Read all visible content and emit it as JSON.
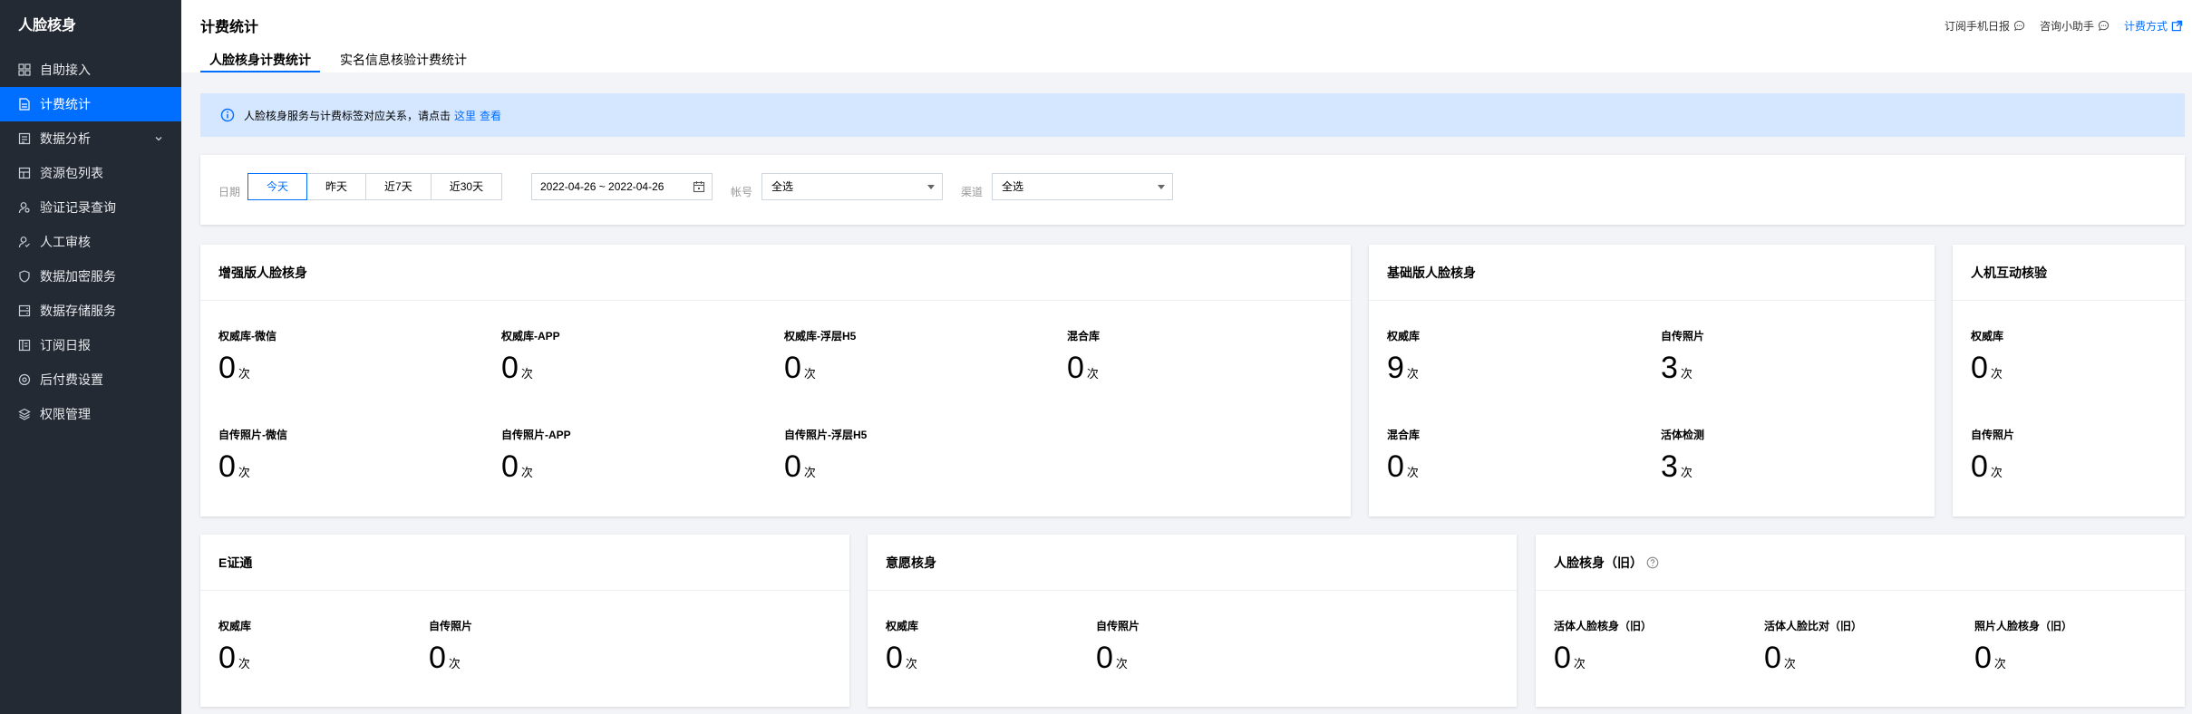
{
  "sidebar": {
    "brand": "人脸核身",
    "items": [
      {
        "label": "自助接入",
        "icon": "grid-icon"
      },
      {
        "label": "计费统计",
        "icon": "document-icon",
        "active": true
      },
      {
        "label": "数据分析",
        "icon": "report-icon",
        "expandable": true
      },
      {
        "label": "资源包列表",
        "icon": "package-icon"
      },
      {
        "label": "验证记录查询",
        "icon": "user-search-icon"
      },
      {
        "label": "人工审核",
        "icon": "user-check-icon"
      },
      {
        "label": "数据加密服务",
        "icon": "shield-icon"
      },
      {
        "label": "数据存储服务",
        "icon": "storage-icon"
      },
      {
        "label": "订阅日报",
        "icon": "calendar-doc-icon"
      },
      {
        "label": "后付费设置",
        "icon": "settings-circle-icon"
      },
      {
        "label": "权限管理",
        "icon": "layers-icon"
      }
    ]
  },
  "header": {
    "title": "计费统计",
    "tabs": [
      "人脸核身计费统计",
      "实名信息核验计费统计"
    ],
    "links": {
      "subscribe": "订阅手机日报",
      "assistant": "咨询小助手",
      "billing": "计费方式"
    }
  },
  "banner": {
    "text": "人脸核身服务与计费标签对应关系，请点击",
    "here": "这里",
    "view": "查看"
  },
  "filters": {
    "date_label": "日期",
    "date_buttons": [
      "今天",
      "昨天",
      "近7天",
      "近30天"
    ],
    "date_range": "2022-04-26 ~ 2022-04-26",
    "account_label": "帐号",
    "account_value": "全选",
    "channel_label": "渠道",
    "channel_value": "全选"
  },
  "unit": "次",
  "cards": {
    "enhanced": {
      "title": "增强版人脸核身",
      "metrics": [
        {
          "label": "权威库-微信",
          "value": "0"
        },
        {
          "label": "权威库-APP",
          "value": "0"
        },
        {
          "label": "权威库-浮层H5",
          "value": "0"
        },
        {
          "label": "混合库",
          "value": "0"
        },
        {
          "label": "自传照片-微信",
          "value": "0"
        },
        {
          "label": "自传照片-APP",
          "value": "0"
        },
        {
          "label": "自传照片-浮层H5",
          "value": "0"
        }
      ]
    },
    "basic": {
      "title": "基础版人脸核身",
      "metrics": [
        {
          "label": "权威库",
          "value": "9"
        },
        {
          "label": "自传照片",
          "value": "3"
        },
        {
          "label": "混合库",
          "value": "0"
        },
        {
          "label": "活体检测",
          "value": "3"
        }
      ]
    },
    "interactive": {
      "title": "人机互动核验",
      "metrics": [
        {
          "label": "权威库",
          "value": "0"
        },
        {
          "label": "自传照片",
          "value": "0"
        }
      ]
    },
    "eid": {
      "title": "E证通",
      "metrics": [
        {
          "label": "权威库",
          "value": "0"
        },
        {
          "label": "自传照片",
          "value": "0"
        }
      ]
    },
    "intent": {
      "title": "意愿核身",
      "metrics": [
        {
          "label": "权威库",
          "value": "0"
        },
        {
          "label": "自传照片",
          "value": "0"
        }
      ]
    },
    "legacy": {
      "title": "人脸核身（旧）",
      "metrics": [
        {
          "label": "活体人脸核身（旧）",
          "value": "0"
        },
        {
          "label": "活体人脸比对（旧）",
          "value": "0"
        },
        {
          "label": "照片人脸核身（旧）",
          "value": "0"
        }
      ]
    }
  },
  "colors": {
    "accent": "#006eff",
    "sidebar_bg": "#242a33",
    "banner_bg": "#d5e7ff",
    "page_bg": "#f3f4f7"
  }
}
